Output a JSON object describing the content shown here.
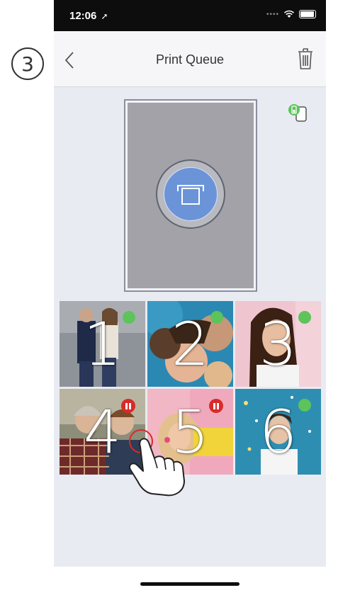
{
  "step_marker": "3",
  "status_bar": {
    "time": "12:06",
    "location_arrow": "location-arrow-icon",
    "signal": "cellular-dots-icon",
    "wifi": "wifi-icon",
    "battery": "battery-icon"
  },
  "nav": {
    "title": "Print Queue",
    "back_icon": "chevron-left-icon",
    "trash_icon": "trash-icon"
  },
  "printer_status_icon": "printer-battery-icon",
  "print_button_icon": "print-icon",
  "queue": [
    {
      "label": "1",
      "status": "ready",
      "status_color": "#5cc45a"
    },
    {
      "label": "2",
      "status": "ready",
      "status_color": "#5cc45a"
    },
    {
      "label": "3",
      "status": "ready",
      "status_color": "#5cc45a"
    },
    {
      "label": "4",
      "status": "paused",
      "status_color": "#d92a2a"
    },
    {
      "label": "5",
      "status": "paused",
      "status_color": "#d92a2a"
    },
    {
      "label": "6",
      "status": "ready",
      "status_color": "#5cc45a"
    }
  ],
  "colors": {
    "accent_blue": "#6b94d8",
    "ready_green": "#5cc45a",
    "paused_red": "#d92a2a",
    "background": "#e8ebf1"
  }
}
